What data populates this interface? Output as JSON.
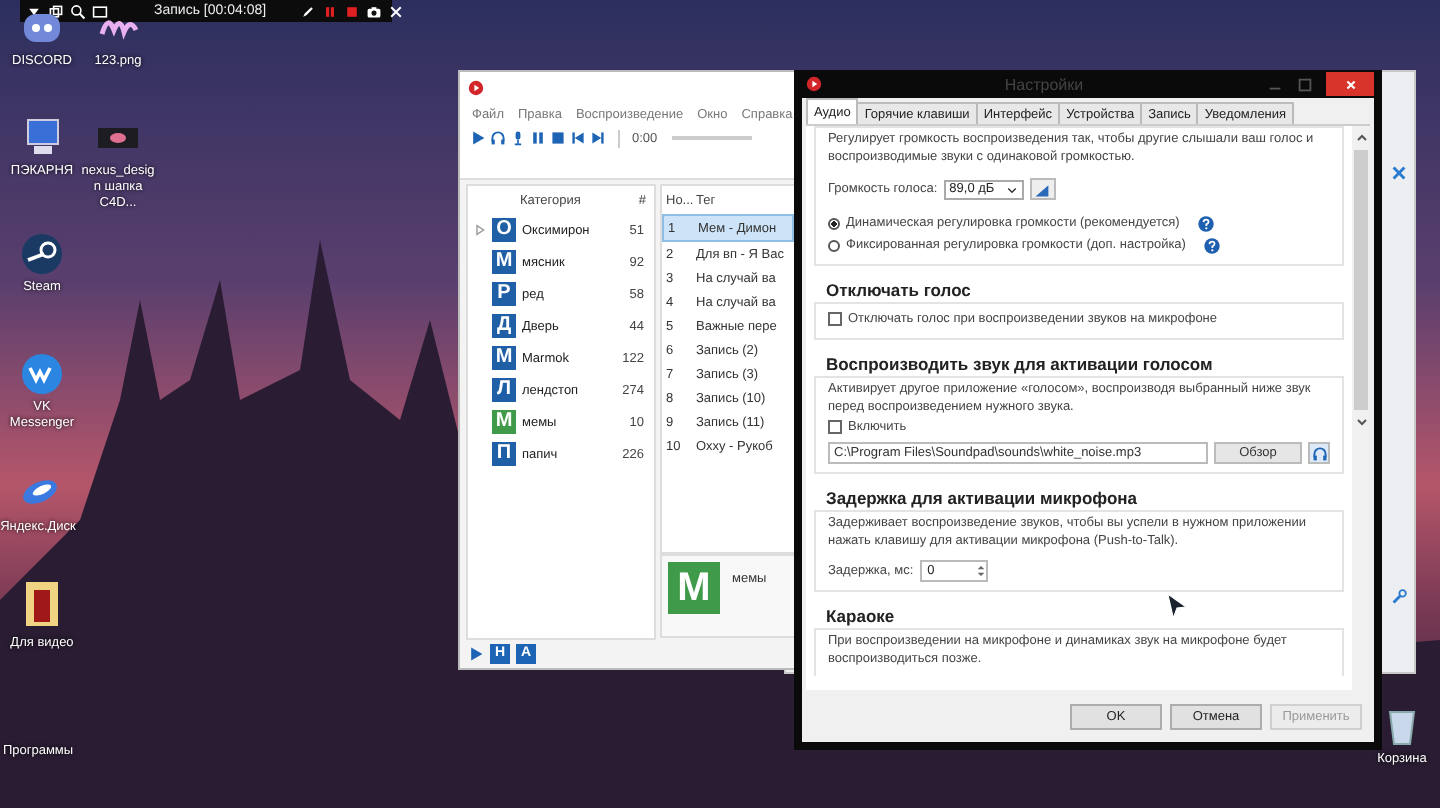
{
  "recording_bar": {
    "title": "Запись [00:04:08]"
  },
  "desktop_icons": [
    {
      "label": "DISCORD",
      "kind": "discord"
    },
    {
      "label": "123.png",
      "kind": "image"
    },
    {
      "label": "ПЭКАРНЯ",
      "kind": "computer"
    },
    {
      "label": "nexus_design шапка C4D...",
      "kind": "thumbnail"
    },
    {
      "label": "Steam",
      "kind": "steam"
    },
    {
      "label": "VK Messenger",
      "kind": "vk"
    },
    {
      "label": "Яндекс.Диск",
      "kind": "disk"
    },
    {
      "label": "Для видео",
      "kind": "folder"
    },
    {
      "label": "Программы",
      "kind": "blank"
    },
    {
      "label": "Корзина",
      "kind": "trash"
    }
  ],
  "soundpad": {
    "menu": [
      "Файл",
      "Правка",
      "Воспроизведение",
      "Окно",
      "Справка"
    ],
    "time": "0:00",
    "seek": {
      "level": 0
    },
    "category_columns": [
      "Категория",
      "#"
    ],
    "categories": [
      {
        "letter": "О",
        "name": "Оксимирон",
        "count": "51",
        "color": "#1f5fa6",
        "expandable": true
      },
      {
        "letter": "М",
        "name": "мясник",
        "count": "92",
        "color": "#1f5fa6",
        "expandable": false
      },
      {
        "letter": "Р",
        "name": "ред",
        "count": "58",
        "color": "#1f5fa6",
        "expandable": false
      },
      {
        "letter": "Д",
        "name": "Дверь",
        "count": "44",
        "color": "#1f5fa6",
        "expandable": false
      },
      {
        "letter": "М",
        "name": "Marmok",
        "count": "122",
        "color": "#1f5fa6",
        "expandable": false
      },
      {
        "letter": "Л",
        "name": "лендстоп",
        "count": "274",
        "color": "#1f5fa6",
        "expandable": false
      },
      {
        "letter": "М",
        "name": "мемы",
        "count": "10",
        "color": "#3f9a4a",
        "expandable": false
      },
      {
        "letter": "П",
        "name": "папич",
        "count": "226",
        "color": "#1f5fa6",
        "expandable": false
      }
    ],
    "sound_columns": [
      "Но...",
      "Тег"
    ],
    "sounds": [
      {
        "number": "1",
        "tag": "Мем - Димон",
        "selected": true
      },
      {
        "number": "2",
        "tag": "Для вп - Я Вас",
        "selected": false
      },
      {
        "number": "3",
        "tag": "На случай ва",
        "selected": false
      },
      {
        "number": "4",
        "tag": "На случай ва",
        "selected": false
      },
      {
        "number": "5",
        "tag": "Важные пере",
        "selected": false
      },
      {
        "number": "6",
        "tag": "Запись (2)",
        "selected": false
      },
      {
        "number": "7",
        "tag": "Запись (3)",
        "selected": false
      },
      {
        "number": "8",
        "tag": "Запись (10)",
        "selected": false
      },
      {
        "number": "9",
        "tag": "Запись (11)",
        "selected": false
      },
      {
        "number": "10",
        "tag": "Охху - Рукоб",
        "selected": false
      }
    ],
    "preview": {
      "letter": "М",
      "name": "мемы",
      "color": "#3f9a4a"
    },
    "bottom_buttons": [
      "Н",
      "А"
    ]
  },
  "settings": {
    "title": "Настройки",
    "tabs": [
      {
        "label": "Аудио",
        "selected": true
      },
      {
        "label": "Горячие клавиши",
        "selected": false
      },
      {
        "label": "Интерфейс",
        "selected": false
      },
      {
        "label": "Устройства",
        "selected": false
      },
      {
        "label": "Запись",
        "selected": false
      },
      {
        "label": "Уведомления",
        "selected": false
      }
    ],
    "intro": "Регулирует громкость воспроизведения так, чтобы другие слышали ваш голос и воспроизводимые звуки с одинаковой громкостью.",
    "volume_label": "Громкость голоса:",
    "volume_value": "89,0 дБ",
    "radios": [
      {
        "label": "Динамическая регулировка громкости (рекомендуется)",
        "selected": true
      },
      {
        "label": "Фиксированная регулировка громкости (доп. настройка)",
        "selected": false
      }
    ],
    "mute_section": {
      "title": "Отключать голос",
      "checkbox": {
        "label": "Отключать голос при воспроизведении звуков на микрофоне",
        "checked": false
      }
    },
    "activation_section": {
      "title": "Воспроизводить звук для активации голосом",
      "description": "Активирует другое приложение «голосом», воспроизводя выбранный ниже звук перед воспроизведением нужного звука.",
      "checkbox": {
        "label": "Включить",
        "checked": false
      },
      "file_path": "C:\\Program Files\\Soundpad\\sounds\\white_noise.mp3",
      "browse_button": "Обзор"
    },
    "delay_section": {
      "title": "Задержка для активации микрофона",
      "description": "Задерживает воспроизведение звуков, чтобы вы успели в нужном приложении нажать клавишу для активации микрофона (Push-to-Talk).",
      "delay_label": "Задержка, мс:",
      "delay_value": "0"
    },
    "karaoke_section": {
      "title": "Караоке",
      "description": "При воспроизведении на микрофоне и динамиках звук на микрофоне будет воспроизводиться позже."
    },
    "buttons": [
      {
        "label": "OK",
        "disabled": false
      },
      {
        "label": "Отмена",
        "disabled": false
      },
      {
        "label": "Применить",
        "disabled": true
      }
    ]
  }
}
